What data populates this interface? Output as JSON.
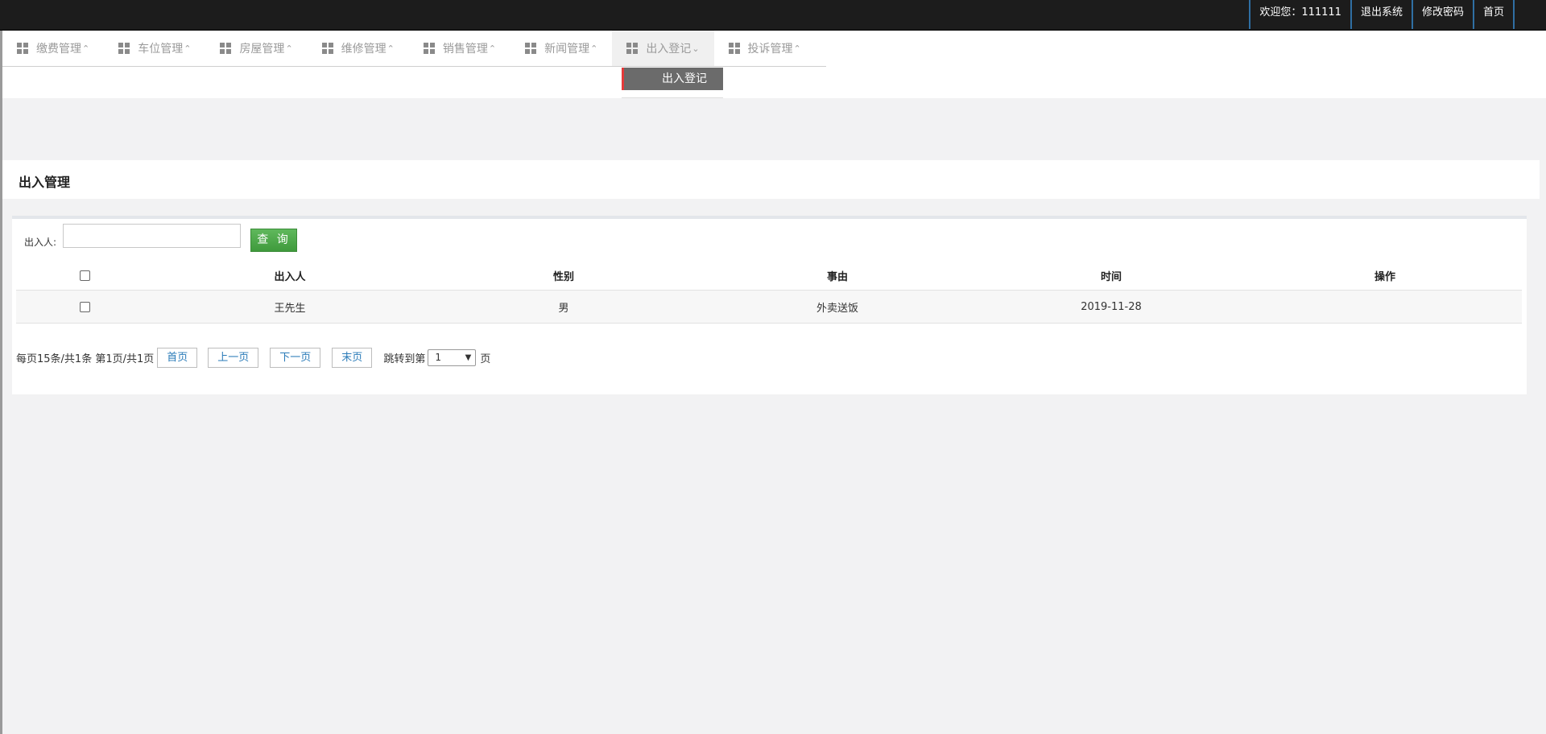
{
  "topbar": {
    "welcome": "欢迎您：111111",
    "logout": "退出系统",
    "change_password": "修改密码",
    "home": "首页"
  },
  "nav": {
    "items": [
      {
        "label": "缴费管理",
        "arrow": "^"
      },
      {
        "label": "车位管理",
        "arrow": "^"
      },
      {
        "label": "房屋管理",
        "arrow": "^"
      },
      {
        "label": "维修管理",
        "arrow": "^"
      },
      {
        "label": "销售管理",
        "arrow": "^"
      },
      {
        "label": "新闻管理",
        "arrow": "^"
      },
      {
        "label": "出入登记",
        "arrow": "v",
        "active": true
      },
      {
        "label": "投诉管理",
        "arrow": "^"
      }
    ],
    "submenu": {
      "label": "出入登记"
    }
  },
  "page": {
    "title": "出入管理"
  },
  "search": {
    "label": "出入人:",
    "value": "",
    "button": "查 询"
  },
  "table": {
    "headers": [
      "",
      "出入人",
      "性别",
      "事由",
      "时间",
      "操作"
    ],
    "rows": [
      {
        "person": "王先生",
        "gender": "男",
        "reason": "外卖送饭",
        "time": "2019-11-28",
        "action": ""
      }
    ]
  },
  "pager": {
    "summary": "每页15条/共1条 第1页/共1页",
    "first": "首页",
    "prev": "上一页",
    "next": "下一页",
    "last": "末页",
    "jump_label": "跳转到第",
    "page_value": "1",
    "page_suffix": "页"
  },
  "colors": {
    "topbar": "#1c1c1c",
    "search_button": "#4cad49",
    "submenu_bg": "#6b6b6b",
    "submenu_accent": "#e43a3a",
    "link": "#2a7bb8"
  }
}
